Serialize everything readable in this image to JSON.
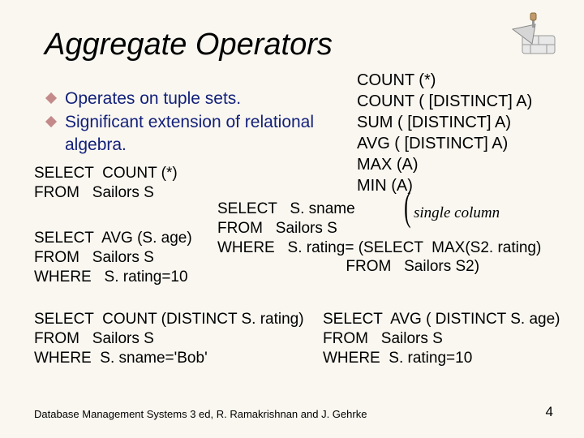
{
  "title": "Aggregate Operators",
  "bullets": {
    "b1": "Operates on tuple sets.",
    "b2": "Significant extension of relational algebra."
  },
  "ops": {
    "l1": "COUNT (*)",
    "l2": "COUNT ( [DISTINCT] A)",
    "l3": "SUM ( [DISTINCT] A)",
    "l4": "AVG ( [DISTINCT] A)",
    "l5": "MAX (A)",
    "l6": "MIN (A)"
  },
  "single_column": "single column",
  "q1": "SELECT  COUNT (*)\nFROM   Sailors S",
  "q2": "SELECT  AVG (S. age)\nFROM   Sailors S\nWHERE   S. rating=10",
  "q3": "SELECT   S. sname\nFROM   Sailors S\nWHERE   S. rating= (SELECT  MAX(S2. rating)\n                              FROM   Sailors S2)",
  "q4": "SELECT  COUNT (DISTINCT S. rating)\nFROM   Sailors S\nWHERE  S. sname='Bob'",
  "q5": "SELECT  AVG ( DISTINCT S. age)\nFROM   Sailors S\nWHERE  S. rating=10",
  "footer": "Database Management Systems 3 ed,  R. Ramakrishnan and J. Gehrke",
  "page": "4"
}
